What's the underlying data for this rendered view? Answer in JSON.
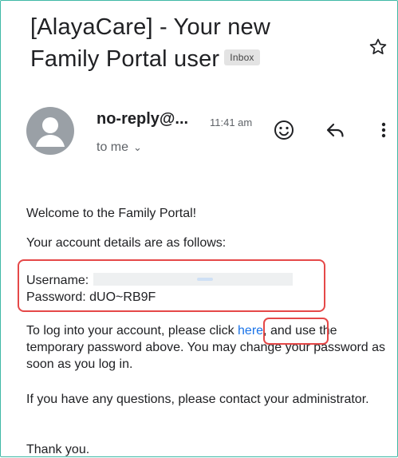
{
  "email": {
    "subject_line1": "[AlayaCare] - Your new",
    "subject_line2": "Family Portal user",
    "label_badge": "Inbox",
    "sender": "no-reply@...",
    "time": "11:41 am",
    "recipient": "to me",
    "body": {
      "greeting": "Welcome to the Family Portal!",
      "intro": "Your account details are as follows:",
      "username_label": "Username:",
      "password_label": "Password:",
      "password_value": "dUO~RB9F",
      "login_prefix": "To log into your account, please click ",
      "login_link": "here",
      "login_suffix": ", and use the temporary password above. You may change your password as soon as you log in.",
      "questions": "If you have any questions, please contact your administrator.",
      "closing": "Thank you."
    }
  },
  "icons": {
    "star": "star-outline",
    "avatar": "person-avatar",
    "emoji": "smiley-face",
    "reply": "reply-arrow",
    "more": "vertical-dots"
  },
  "colors": {
    "link": "#1a73e8",
    "annotation_box": "#e54848",
    "frame_border": "#3fb9a6"
  }
}
